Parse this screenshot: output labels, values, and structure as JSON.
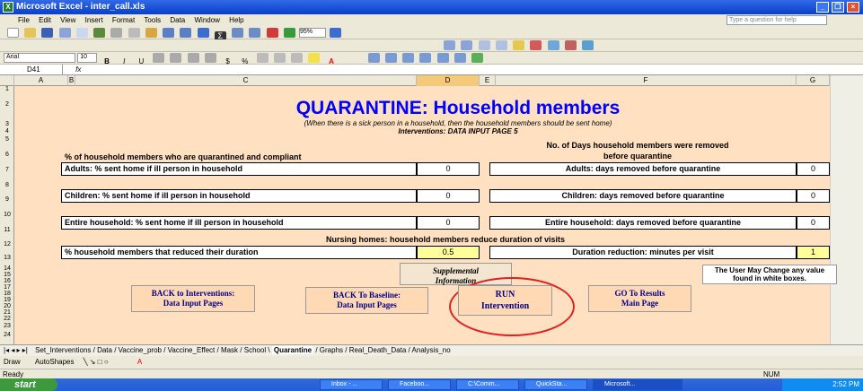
{
  "window": {
    "title": "Microsoft Excel - inter_call.xls"
  },
  "menu": [
    "File",
    "Edit",
    "View",
    "Insert",
    "Format",
    "Tools",
    "Data",
    "Window",
    "Help"
  ],
  "help_placeholder": "Type a question for help",
  "toolbar": {
    "zoom": "95%",
    "font": "Arial",
    "font_size": "10"
  },
  "formula": {
    "cell_ref": "D41",
    "fx": "fx",
    "value": ""
  },
  "columns": [
    "A",
    "B",
    "C",
    "D",
    "E",
    "F",
    "G"
  ],
  "rows": [
    "1",
    "2",
    "3",
    "4",
    "5",
    "6",
    "7",
    "8",
    "9",
    "10",
    "11",
    "12",
    "13",
    "14",
    "15",
    "16",
    "17",
    "18",
    "19",
    "20",
    "21",
    "22",
    "23",
    "24"
  ],
  "sheet": {
    "title": "QUARANTINE: Household members",
    "subtitle": "(When there is a sick person in a household, then the household members should be sent home)",
    "interventions": "Interventions: DATA INPUT PAGE 5",
    "left_header": "% of household members who are quarantined and compliant",
    "right_header_1": "No. of Days household members were removed",
    "right_header_2": "before quarantine",
    "rows": [
      {
        "left": "Adults: % sent home if ill person in household",
        "left_val": "0",
        "right": "Adults: days removed before quarantine",
        "right_val": "0"
      },
      {
        "left": "Children: % sent home if ill person in household",
        "left_val": "0",
        "right": "Children: days removed before quarantine",
        "right_val": "0"
      },
      {
        "left": "Entire household: % sent home if ill person in household",
        "left_val": "0",
        "right": "Entire household: days removed before quarantine",
        "right_val": "0"
      }
    ],
    "nursing_header": "Nursing homes: household members reduce duration of visits",
    "nursing_left": "% household members that reduced their duration",
    "nursing_left_val": "0.5",
    "nursing_right": "Duration reduction: minutes per visit",
    "nursing_right_val": "1",
    "supplemental_1": "Supplemental",
    "supplemental_2": "Information",
    "note": "The User May Change any value found in white boxes.",
    "btn_interventions_1": "BACK to Interventions:",
    "btn_interventions_2": "Data Input Pages",
    "btn_baseline_1": "BACK To Baseline:",
    "btn_baseline_2": "Data Input Pages",
    "btn_run_1": "RUN",
    "btn_run_2": "Intervention",
    "btn_results_1": "GO To Results",
    "btn_results_2": "Main Page"
  },
  "tabs": [
    "Set_Interventions",
    "Data",
    "Vaccine_prob",
    "Vaccine_Effect",
    "Mask",
    "School",
    "Quarantine",
    "Graphs",
    "Real_Death_Data",
    "Analysis_no"
  ],
  "draw": {
    "label": "Draw",
    "autoshapes": "AutoShapes"
  },
  "status": {
    "left": "Ready",
    "right": "NUM"
  },
  "taskbar": {
    "start": "start",
    "items": [
      "Inbox - ...",
      "Faceboo...",
      "C:\\Comm...",
      "QuickSta...",
      "Microsoft..."
    ],
    "time": "2:52 PM"
  }
}
